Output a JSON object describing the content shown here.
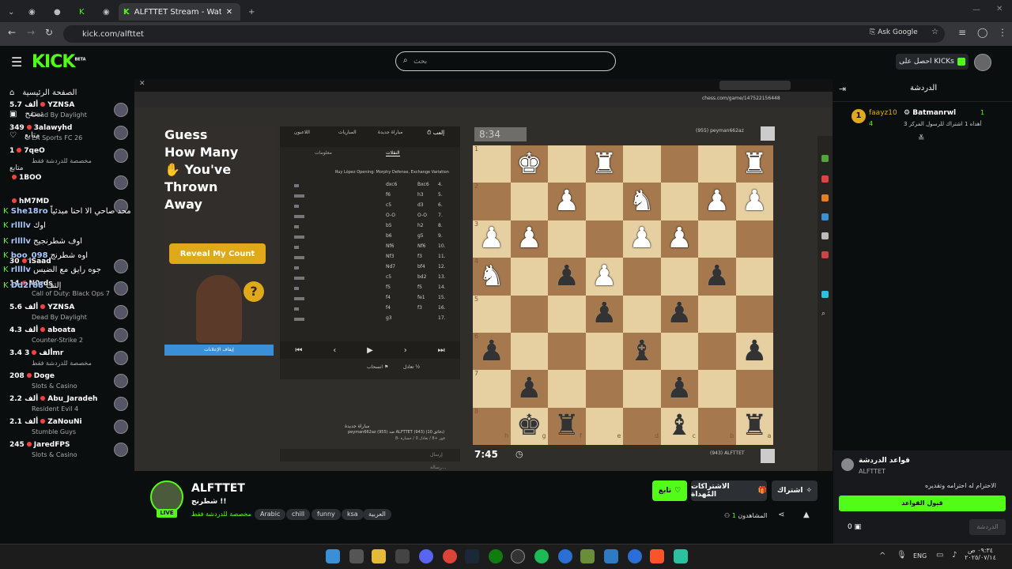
{
  "browser": {
    "active_tab_title": "ALFTTET Stream - Watch Li",
    "url": "kick.com/alfttet",
    "ask_google": "Ask Google"
  },
  "header": {
    "logo": "KICK",
    "logo_beta": "BETA",
    "search_placeholder": "بحث",
    "get_kicks": "احصل على KICKs"
  },
  "sidebar": {
    "nav": [
      {
        "label": "الصفحة الرئيسية",
        "icon": "home-icon"
      },
      {
        "label": "تصفح",
        "icon": "browse-icon"
      },
      {
        "label": "متابع",
        "icon": "heart-icon"
      }
    ],
    "following_title": "متابع",
    "following": [
      {
        "name": "YZNSA",
        "viewers": "5.7 ألف",
        "game": "Dead By Daylight"
      },
      {
        "name": "3alawyhd",
        "viewers": "349",
        "game": "EA Sports FC 26"
      },
      {
        "name": "7qeO",
        "viewers": "1",
        "game": "مخصصة للدردشة فقط"
      },
      {
        "name": "1BOO",
        "viewers": "",
        "game": ""
      },
      {
        "name": "hM7MD",
        "viewers": "",
        "game": ""
      },
      {
        "name": "iSaad",
        "viewers": "30",
        "game": ""
      },
      {
        "name": "N0rds",
        "viewers": "14",
        "game": "Call of Duty: Black Ops 7"
      },
      {
        "name": "YZNSA",
        "viewers": "5.6 ألف",
        "game": "Dead By Daylight"
      },
      {
        "name": "aboata",
        "viewers": "4.3 ألف",
        "game": "Counter-Strike 2"
      },
      {
        "name": "3mr",
        "viewers": "3.4 ألف",
        "game": "مخصصة للدردشة فقط"
      },
      {
        "name": "Doge",
        "viewers": "208",
        "game": "Slots & Casino"
      },
      {
        "name": "Abu_Jaradeh",
        "viewers": "2.2 ألف",
        "game": "Resident Evil 4"
      },
      {
        "name": "ZaNouNi",
        "viewers": "2.1 ألف",
        "game": "Stumble Guys"
      },
      {
        "name": "JaredFPS",
        "viewers": "245",
        "game": "Slots & Casino"
      }
    ],
    "chat_overlay": [
      {
        "user": "She18ro",
        "text": "محد صاحي الا احنا مبدئياً"
      },
      {
        "user": "rllllv",
        "text": "اوك"
      },
      {
        "user": "rllllv",
        "text": "اوف شطرنجيج"
      },
      {
        "user": "boo_098",
        "text": "اوه شطرنج"
      },
      {
        "user": "rllllv",
        "text": "جوه رايق مع الضيس"
      },
      {
        "user": "Dd2r88",
        "text": "إلتف"
      }
    ]
  },
  "stream": {
    "chess_url": "chess.com/game/147522156448",
    "ad": {
      "title": "Guess\nHow Many\n✋ You've\nThrown\nAway",
      "button": "Reveal My Count",
      "bottom_button": "إيقاف الإعلانات"
    },
    "panel_tabs": [
      "إلعب",
      "مباراة جديدة",
      "المباريات",
      "اللاعبون"
    ],
    "panel_subtabs": [
      "النقلات",
      "معلومات"
    ],
    "opening": "Ruy López Opening: Morphy Defense, Exchange Variation",
    "moves": [
      {
        "n": "4.",
        "w": "Bxc6",
        "b": "dxc6"
      },
      {
        "n": "5.",
        "w": "h3",
        "b": "f6"
      },
      {
        "n": "6.",
        "w": "d3",
        "b": "c5"
      },
      {
        "n": "7.",
        "w": "O-O",
        "b": "O-O"
      },
      {
        "n": "8.",
        "w": "h2",
        "b": "b5"
      },
      {
        "n": "9.",
        "w": "g5",
        "b": "b6"
      },
      {
        "n": "10.",
        "w": "Nf6",
        "b": "Nf6"
      },
      {
        "n": "11.",
        "w": "f3",
        "b": "Nf3"
      },
      {
        "n": "12.",
        "w": "bf4",
        "b": "Nd7"
      },
      {
        "n": "13.",
        "w": "bd2",
        "b": "c5"
      },
      {
        "n": "14.",
        "w": "f5",
        "b": "f5"
      },
      {
        "n": "15.",
        "w": "fe1",
        "b": "f4"
      },
      {
        "n": "16.",
        "w": "f3",
        "b": "f4"
      },
      {
        "n": "17.",
        "w": "",
        "b": "g3"
      }
    ],
    "draw_label": "تعادل",
    "resign_label": "انسحاب",
    "new_game": "مباراة جديدة",
    "game_desc": "peyman662az (955) ضد ALFTTET (943) (10 دقائق)",
    "game_result": "فوز +8 / تعادل 0 / خسارة -8",
    "message_placeholder": "إرسال رسالة...",
    "timer_top": "8:34",
    "timer_bottom": "7:45",
    "opponent": "peyman662az",
    "opponent_rating": "(955)",
    "player": "ALFTTET",
    "player_rating": "(943)",
    "files": [
      "h",
      "g",
      "f",
      "e",
      "d",
      "c",
      "b",
      "a"
    ],
    "ranks": [
      "1",
      "2",
      "3",
      "4",
      "5",
      "6",
      "7",
      "8"
    ],
    "board": [
      [
        "",
        "wK",
        "",
        "wR",
        "",
        "",
        "",
        "wR"
      ],
      [
        "",
        "",
        "wP",
        "",
        "wN",
        "",
        "wP",
        "wP"
      ],
      [
        "wP",
        "wP",
        "",
        "",
        "wP",
        "wP",
        "",
        ""
      ],
      [
        "wN",
        "",
        "bP",
        "wP",
        "",
        "",
        "bP",
        ""
      ],
      [
        "",
        "",
        "",
        "bP",
        "",
        "bP",
        "",
        ""
      ],
      [
        "bP",
        "",
        "",
        "",
        "bB",
        "",
        "",
        "bP"
      ],
      [
        "",
        "bP",
        "",
        "",
        "",
        "bP",
        "",
        ""
      ],
      [
        "",
        "bK",
        "bR",
        "",
        "",
        "bB",
        "",
        "bR"
      ]
    ]
  },
  "channel": {
    "name": "ALFTTET",
    "title": "شطرنج !!",
    "category": "مخصصة للدردشة فقط",
    "live": "LIVE",
    "tags": [
      "Arabic",
      "chill",
      "funny",
      "ksa",
      "العربية"
    ],
    "follow": "تابع",
    "gift_subs": "الاشتراكات المُهداة",
    "subscribe": "اشتراك",
    "viewers": "1",
    "viewers_label": "المشاهدون"
  },
  "chat": {
    "title": "الدردشة",
    "gifter": "Batmanrwl",
    "gifter_count": "1",
    "gift_text": "أهداه 1 اشتراك للرسول المركز 3",
    "top_user": "faayz10",
    "top_count": "4",
    "rules_title": "قواعد الدردشة",
    "rules_channel": "ALFTTET",
    "rules_text": "الاحترام له احترامه وتقديره",
    "accept_rules": "قبول القواعد",
    "kicks_count": "0",
    "send_button": "الدردشة"
  },
  "taskbar": {
    "lang": "ENG",
    "time": "٠٩:٣٤ ص",
    "date": "٢٠٢٥/٠٧/١٤"
  }
}
